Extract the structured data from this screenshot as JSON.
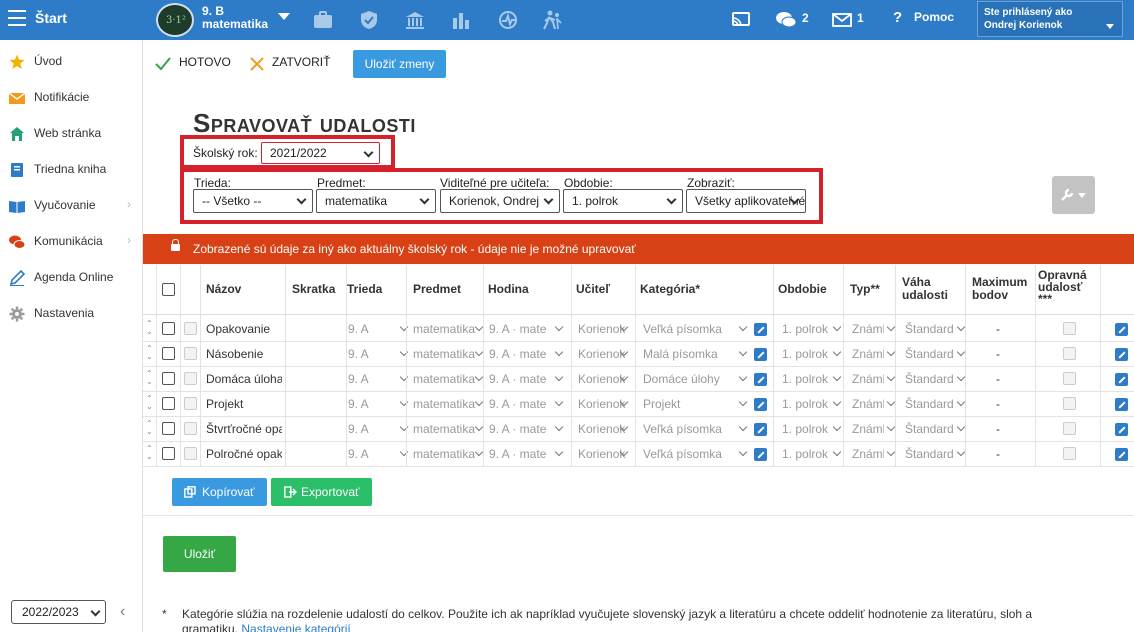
{
  "topbar": {
    "start": "Štart",
    "class_line1": "9. B",
    "class_line2": "matematika",
    "messages_count": "2",
    "mail_count": "1",
    "help": "Pomoc",
    "login_label": "Ste prihlásený ako",
    "login_user": "Ondrej Korienok",
    "icons": [
      "briefcase-icon",
      "shield-icon",
      "bank-icon",
      "bar-chart-icon",
      "activity-icon",
      "walking-icon",
      "cast-icon",
      "chat-icon",
      "mail-icon",
      "question-icon"
    ]
  },
  "sidebar": {
    "items": [
      {
        "label": "Úvod",
        "icon": "star-icon",
        "color": "#f0b400"
      },
      {
        "label": "Notifikácie",
        "icon": "envelope-icon",
        "color": "#f29a1e"
      },
      {
        "label": "Web stránka",
        "icon": "home-icon",
        "color": "#24a07a"
      },
      {
        "label": "Triedna kniha",
        "icon": "book-icon",
        "color": "#2e7cc7"
      },
      {
        "label": "Vyučovanie",
        "icon": "open-book-icon",
        "color": "#2e7cc7"
      },
      {
        "label": "Komunikácia",
        "icon": "chat-bubbles-icon",
        "color": "#d84115"
      },
      {
        "label": "Agenda Online",
        "icon": "pen-icon",
        "color": "#2e7cc7"
      },
      {
        "label": "Nastavenia",
        "icon": "gear-icon",
        "color": "#999999"
      }
    ],
    "year": "2022/2023"
  },
  "actions": {
    "done": "HOTOVO",
    "close": "ZATVORIŤ",
    "save_changes": "Uložiť zmeny"
  },
  "page_title": "Spravovať udalosti",
  "school_year": {
    "label": "Školský rok:",
    "value": "2021/2022"
  },
  "filters": [
    {
      "label": "Trieda:",
      "value": "-- Všetko --"
    },
    {
      "label": "Predmet:",
      "value": "matematika"
    },
    {
      "label": "Viditeľné pre učiteľa:",
      "value": "Korienok, Ondrej"
    },
    {
      "label": "Obdobie:",
      "value": "1. polrok"
    },
    {
      "label": "Zobraziť:",
      "value": "Všetky aplikovateľné"
    }
  ],
  "alert": "Zobrazené sú údaje za iný ako aktuálny školský rok - údaje nie je možné upravovať",
  "table": {
    "headers": {
      "name": "Názov",
      "abbr": "Skratka",
      "class": "Trieda",
      "subject": "Predmet",
      "lesson": "Hodina",
      "teacher": "Učiteľ",
      "category": "Kategória*",
      "period": "Obdobie",
      "type": "Typ**",
      "weight_1": "Váha",
      "weight_2": "udalosti",
      "max_1": "Maximum",
      "max_2": "bodov",
      "fix_1": "Opravná",
      "fix_2": "udalosť",
      "fix_3": "***"
    },
    "rows": [
      {
        "name": "Opakovanie",
        "class": "9. A",
        "subject": "matematika",
        "lesson": "9. A · mate",
        "teacher": "Korienok",
        "category": "Veľká písomka",
        "period": "1. polrok",
        "type": "Známka",
        "weight": "Štandard",
        "max": "-"
      },
      {
        "name": "Násobenie",
        "class": "9. A",
        "subject": "matematika",
        "lesson": "9. A · mate",
        "teacher": "Korienok",
        "category": "Malá písomka",
        "period": "1. polrok",
        "type": "Známka",
        "weight": "Štandard",
        "max": "-"
      },
      {
        "name": "Domáca úloha",
        "class": "9. A",
        "subject": "matematika",
        "lesson": "9. A · mate",
        "teacher": "Korienok",
        "category": "Domáce úlohy",
        "period": "1. polrok",
        "type": "Známka",
        "weight": "Štandard",
        "max": "-"
      },
      {
        "name": "Projekt",
        "class": "9. A",
        "subject": "matematika",
        "lesson": "9. A · mate",
        "teacher": "Korienok",
        "category": "Projekt",
        "period": "1. polrok",
        "type": "Známka",
        "weight": "Štandard",
        "max": "-"
      },
      {
        "name": "Štvrťročné opakovanie",
        "class": "9. A",
        "subject": "matematika",
        "lesson": "9. A · mate",
        "teacher": "Korienok",
        "category": "Veľká písomka",
        "period": "1. polrok",
        "type": "Známka",
        "weight": "Štandard",
        "max": "-"
      },
      {
        "name": "Polročné opakovanie",
        "class": "9. A",
        "subject": "matematika",
        "lesson": "9. A · mate",
        "teacher": "Korienok",
        "category": "Veľká písomka",
        "period": "1. polrok",
        "type": "Známka",
        "weight": "Štandard",
        "max": "-"
      }
    ]
  },
  "buttons": {
    "copy": "Kopírovať",
    "export": "Exportovať",
    "save": "Uložiť"
  },
  "note": {
    "mark": "*",
    "text": "Kategórie slúžia na rozdelenie udalostí do celkov. Použite ich ak napríklad vyučujete slovenský jazyk a literatúru a chcete oddeliť hodnotenie za literatúru, sloh a gramatiku.",
    "link": "Nastavenie kategórií"
  }
}
